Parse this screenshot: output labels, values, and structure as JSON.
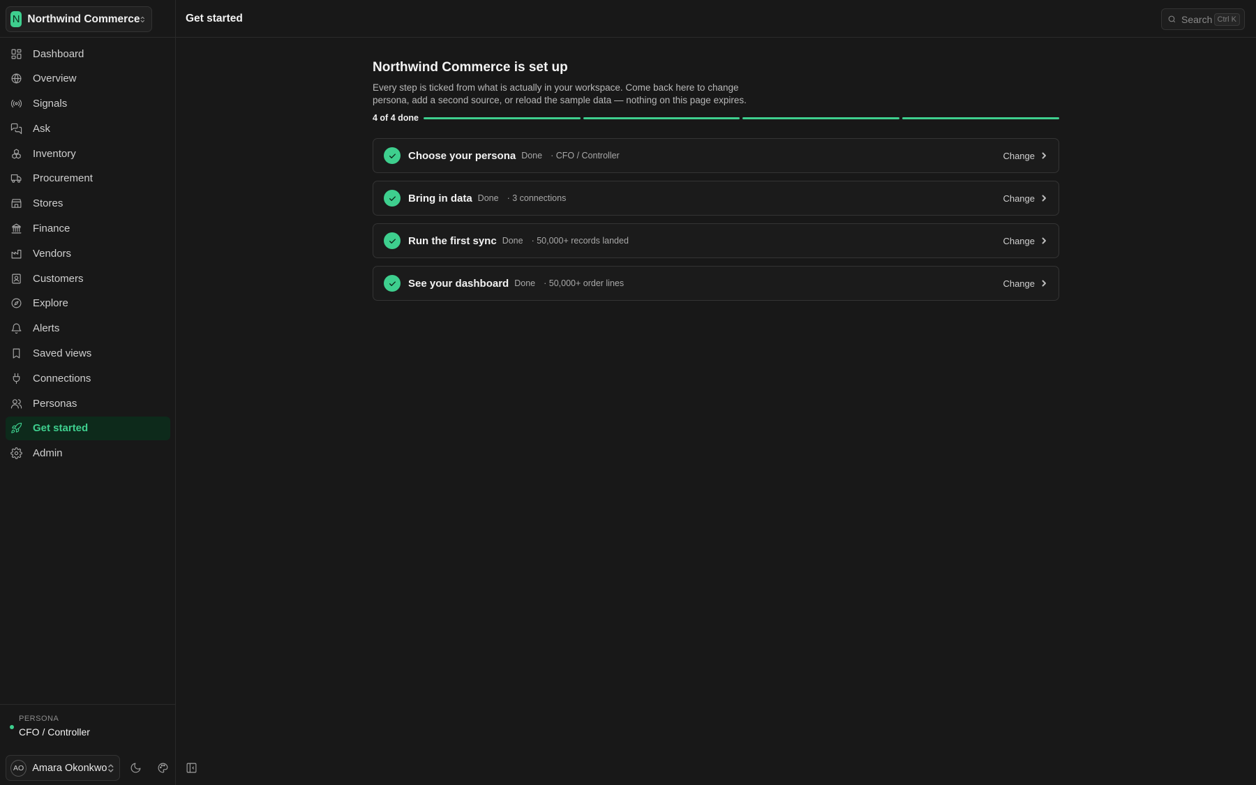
{
  "workspace": {
    "logo_letter": "N",
    "name": "Northwind Commerce"
  },
  "sidebar": {
    "items": [
      {
        "label": "Dashboard",
        "icon": "dashboard-icon"
      },
      {
        "label": "Overview",
        "icon": "globe-icon"
      },
      {
        "label": "Signals",
        "icon": "signals-icon"
      },
      {
        "label": "Ask",
        "icon": "chat-icon"
      },
      {
        "label": "Inventory",
        "icon": "boxes-icon"
      },
      {
        "label": "Procurement",
        "icon": "truck-icon"
      },
      {
        "label": "Stores",
        "icon": "store-icon"
      },
      {
        "label": "Finance",
        "icon": "bank-icon"
      },
      {
        "label": "Vendors",
        "icon": "factory-icon"
      },
      {
        "label": "Customers",
        "icon": "contact-icon"
      },
      {
        "label": "Explore",
        "icon": "compass-icon"
      },
      {
        "label": "Alerts",
        "icon": "bell-icon"
      },
      {
        "label": "Saved views",
        "icon": "bookmark-icon"
      },
      {
        "label": "Connections",
        "icon": "plug-icon"
      },
      {
        "label": "Personas",
        "icon": "users-icon"
      },
      {
        "label": "Get started",
        "icon": "rocket-icon",
        "active": true
      },
      {
        "label": "Admin",
        "icon": "gear-icon"
      }
    ]
  },
  "persona": {
    "caption": "PERSONA",
    "value": "CFO / Controller"
  },
  "user": {
    "initials": "AO",
    "name": "Amara Okonkwo"
  },
  "header": {
    "title": "Get started",
    "search_label": "Search",
    "search_shortcut": "Ctrl K"
  },
  "main": {
    "title": "Northwind Commerce is set up",
    "description": "Every step is ticked from what is actually in your workspace. Come back here to change persona, add a second source, or reload the sample data — nothing on this page expires.",
    "progress_label": "4 of 4 done",
    "progress": {
      "done": 4,
      "total": 4
    },
    "steps": [
      {
        "title": "Choose your persona",
        "status": "Done",
        "detail": "· CFO / Controller",
        "action": "Change"
      },
      {
        "title": "Bring in data",
        "status": "Done",
        "detail": "· 3 connections",
        "action": "Change"
      },
      {
        "title": "Run the first sync",
        "status": "Done",
        "detail": "· 50,000+ records landed",
        "action": "Change"
      },
      {
        "title": "See your dashboard",
        "status": "Done",
        "detail": "· 50,000+ order lines",
        "action": "Change"
      }
    ]
  },
  "colors": {
    "accent": "#3ecf8e",
    "background": "#181818",
    "active_bg": "#0d2a1b"
  }
}
